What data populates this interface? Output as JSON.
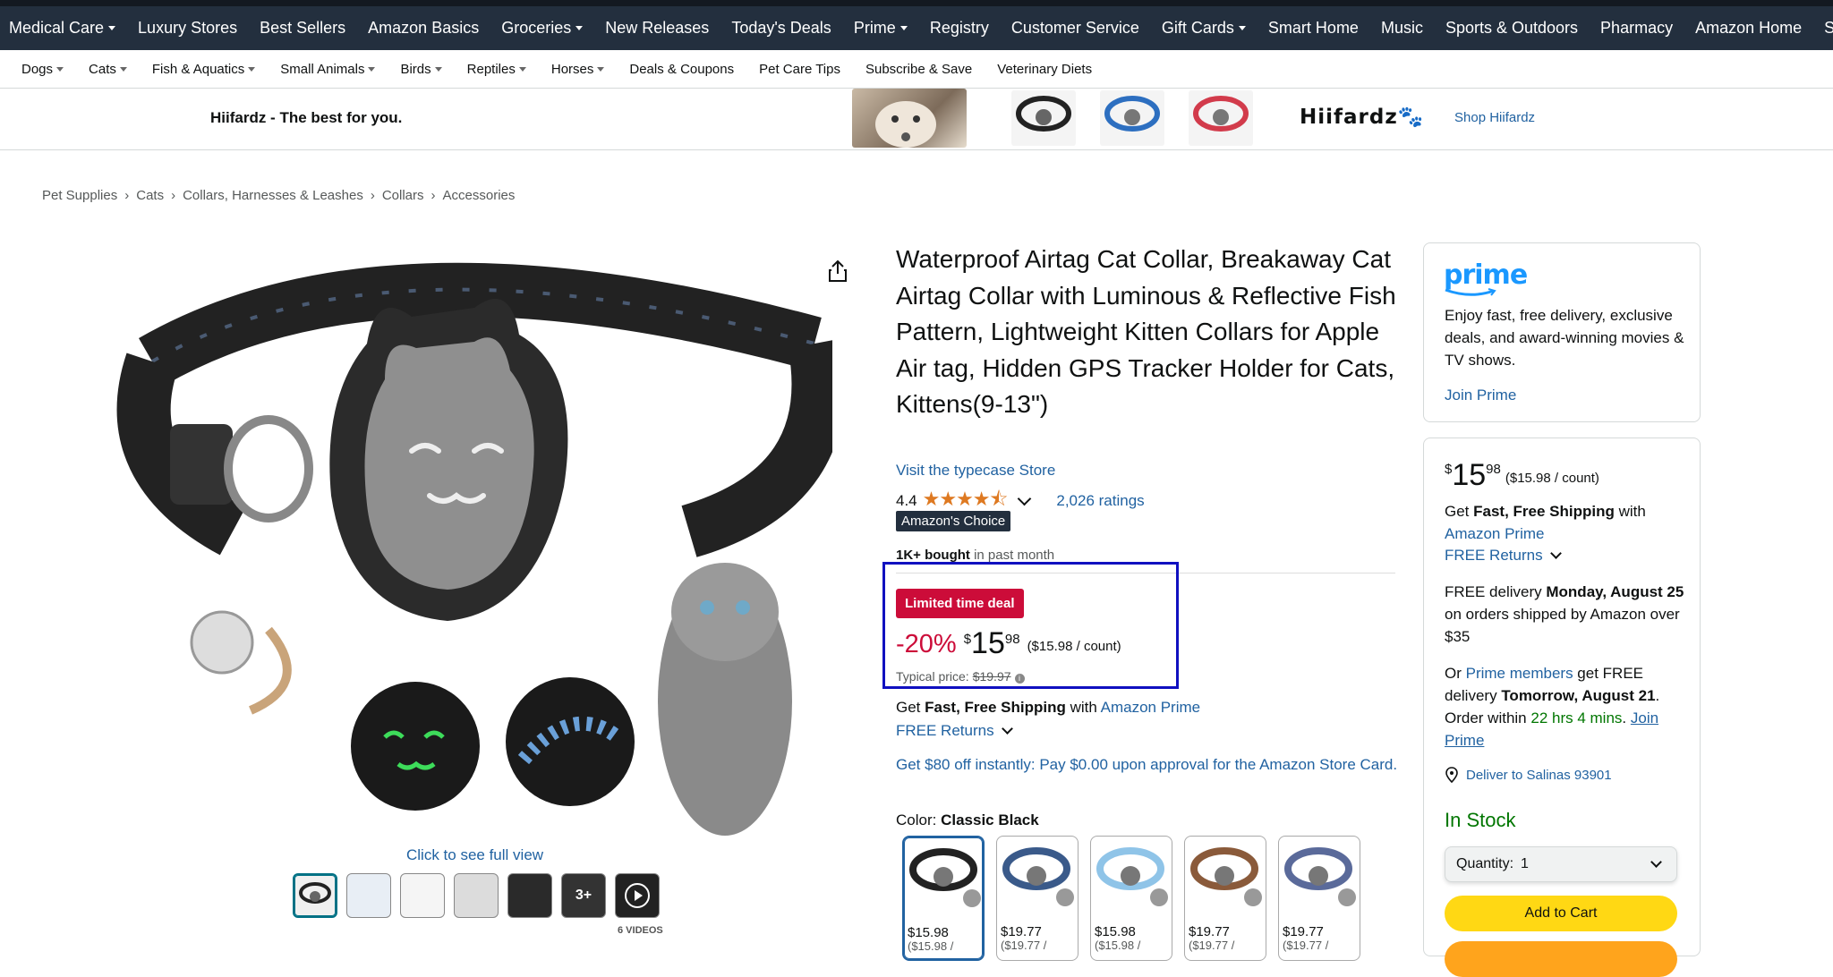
{
  "topnav": {
    "items": [
      "Medical Care",
      "Luxury Stores",
      "Best Sellers",
      "Amazon Basics",
      "Groceries",
      "New Releases",
      "Today's Deals",
      "Prime",
      "Registry",
      "Customer Service",
      "Gift Cards",
      "Smart Home",
      "Music",
      "Sports & Outdoors",
      "Pharmacy",
      "Amazon Home",
      "Shop By Interest"
    ]
  },
  "subnav": {
    "items": [
      "Dogs",
      "Cats",
      "Fish & Aquatics",
      "Small Animals",
      "Birds",
      "Reptiles",
      "Horses",
      "Deals & Coupons",
      "Pet Care Tips",
      "Subscribe & Save",
      "Veterinary Diets"
    ]
  },
  "brandbar": {
    "tagline": "Hiifardz - The best for you.",
    "logo": "Hiifardz",
    "shop_link": "Shop Hiifardz"
  },
  "breadcrumb": [
    "Pet Supplies",
    "Cats",
    "Collars, Harnesses & Leashes",
    "Collars",
    "Accessories"
  ],
  "gallery": {
    "full_view": "Click to see full view",
    "video_overlay": "3+",
    "videos_label": "6 VIDEOS"
  },
  "product": {
    "title": "Waterproof Airtag Cat Collar, Breakaway Cat Airtag Collar with Luminous & Reflective Fish Pattern, Lightweight Kitten Collars for Apple Air tag, Hidden GPS Tracker Holder for Cats, Kittens(9-13\")",
    "store_link": "Visit the typecase Store",
    "rating_value": "4.4",
    "stars": "★★★★⯪",
    "ratings_count": "2,026 ratings",
    "badge": "Amazon's Choice",
    "bought_bold": "1K+ bought",
    "bought_rest": " in past month",
    "deal_badge": "Limited time deal",
    "discount": "-20%",
    "currency": "$",
    "price_whole": "15",
    "price_fraction": "98",
    "unit_price": "($15.98 / count)",
    "typical_label": "Typical price:",
    "typical_price": "$19.97",
    "shipping_prefix": "Get ",
    "shipping_bold": "Fast, Free Shipping",
    "shipping_with": " with ",
    "shipping_link": "Amazon Prime",
    "returns": "FREE Returns",
    "store_card": "Get $80 off instantly: Pay $0.00 upon approval for the Amazon Store Card.",
    "color_label": "Color: ",
    "color_value": "Classic Black",
    "swatches": [
      {
        "price": "$15.98",
        "sub": "($15.98 /"
      },
      {
        "price": "$19.77",
        "sub": "($19.77 /"
      },
      {
        "price": "$15.98",
        "sub": "($15.98 /"
      },
      {
        "price": "$19.77",
        "sub": "($19.77 /"
      },
      {
        "price": "$19.77",
        "sub": "($19.77 /"
      }
    ]
  },
  "prime_box": {
    "logo": "prime",
    "text": "Enjoy fast, free delivery, exclusive deals, and award-winning movies & TV shows.",
    "join": "Join Prime"
  },
  "buybox": {
    "currency": "$",
    "price_whole": "15",
    "price_fraction": "98",
    "unit_price": "($15.98 / count)",
    "ship_prefix": "Get ",
    "ship_bold": "Fast, Free Shipping",
    "ship_with": " with ",
    "ship_link": "Amazon Prime",
    "returns": "FREE Returns",
    "delivery_prefix": "FREE delivery ",
    "delivery_date": "Monday, August 25",
    "delivery_suffix": " on orders shipped by Amazon over $35",
    "or_text": "Or ",
    "members_link": "Prime members",
    "fast_text": " get FREE delivery ",
    "fast_date": "Tomorrow, August 21",
    "order_within": ". Order within ",
    "countdown": "22 hrs 4 mins",
    "join_link": "Join Prime",
    "deliver_to": "Deliver to Salinas 93901",
    "stock": "In Stock",
    "qty_label": "Quantity:",
    "qty_value": "1",
    "add_to_cart": "Add to Cart"
  },
  "colors": {
    "nav_bg": "#232f3e",
    "link": "#2162a1",
    "deal_red": "#cc0c39",
    "stock_green": "#007600",
    "cart_yellow": "#ffd814",
    "highlight_box": "#1010c0"
  }
}
